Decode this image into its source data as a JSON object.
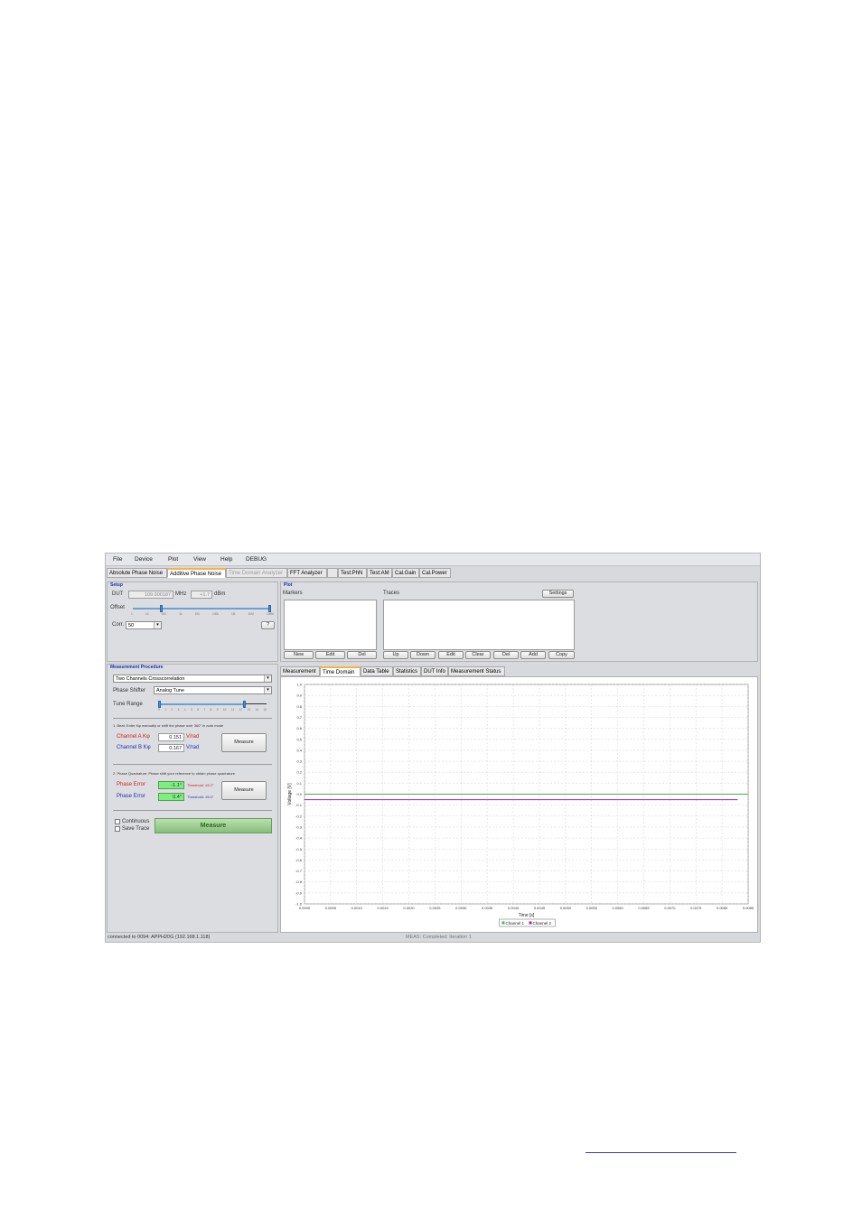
{
  "menu": [
    "File",
    "Device",
    "Plot",
    "View",
    "Help",
    "DEBUG"
  ],
  "tabs": [
    {
      "label": "Absolute Phase Noise",
      "state": "normal"
    },
    {
      "label": "Additive Phase Noise",
      "state": "active"
    },
    {
      "label": "Time Domain Analyzer",
      "state": "disabled"
    },
    {
      "label": "FFT Analyzer",
      "state": "normal"
    },
    {
      "label": "",
      "state": "normal"
    },
    {
      "label": "Test:PhN",
      "state": "normal"
    },
    {
      "label": "Test:AM",
      "state": "normal"
    },
    {
      "label": "Cal.Gain",
      "state": "normal"
    },
    {
      "label": "Cal.Power",
      "state": "normal"
    }
  ],
  "setup": {
    "title": "Setup",
    "dut_label": "DUT",
    "dut_freq": "109.000187",
    "freq_unit": "MHz",
    "dut_power": "+1.7",
    "power_unit": "dBm",
    "offset_label": "Offset",
    "offset_ticks": [
      "1",
      "10",
      "100",
      "1k",
      "10k",
      "100k",
      "1M",
      "10M",
      "100M"
    ],
    "corr_label": "Corr.",
    "corr_value": "50",
    "help_label": "?"
  },
  "plot": {
    "title": "Plot",
    "markers_label": "Markers",
    "traces_label": "Traces",
    "settings_label": "Settings",
    "marker_buttons": [
      "New",
      "Edit",
      "Del"
    ],
    "trace_buttons": [
      "Up",
      "Down",
      "Edit",
      "Clear",
      "Del",
      "Add",
      "Copy"
    ]
  },
  "procedure": {
    "title": "Measurement Procedure",
    "mode": "Two Channels Crosscorrelation",
    "phase_shifter_label": "Phase Shifter",
    "phase_shifter_value": "Analog Tune",
    "tune_range_label": "Tune Range",
    "tune_ticks": [
      "0",
      "1",
      "2",
      "3",
      "4",
      "5",
      "6",
      "7",
      "8",
      "9",
      "10",
      "11",
      "12",
      "13",
      "14",
      "15"
    ],
    "step1_text": "1. Beat: Enter Kφ manually or shift the phase over 360° in auto mode",
    "chan_a_label": "Channel A Kφ",
    "chan_a_value": "0.151",
    "chan_a_unit": "V/rad",
    "chan_b_label": "Channel B Kφ",
    "chan_b_value": "0.167",
    "chan_b_unit": "V/rad",
    "measure1_label": "Measure",
    "step2_text": "2. Phase Quadrature: Phase shift your reference to obtain phase quadrature",
    "phase_err_a_label": "Phase Error",
    "phase_err_a_value": "-1.1°",
    "phase_err_a_thresh": "Threshold: ±5.0°",
    "phase_err_b_label": "Phase Error",
    "phase_err_b_value": "0.4°",
    "phase_err_b_thresh": "Threshold: ±5.0°",
    "measure2_label": "Measure",
    "continuous_label": "Continuous",
    "save_trace_label": "Save Trace",
    "measure_main_label": "Measure"
  },
  "subtabs": [
    "Measurement",
    "Time Domain",
    "Data Table",
    "Statistics",
    "DUT Info",
    "Measurement Status"
  ],
  "active_subtab": "Time Domain",
  "status": {
    "left": "connected to 0094: APPH20G (192.168.1.118)",
    "mid": "MEAS: Completed: Iteration 1"
  },
  "chart_data": {
    "type": "line",
    "xlabel": "Time [s]",
    "ylabel": "Voltage [V]",
    "xlim": [
      0,
      0.0085
    ],
    "ylim": [
      -1.0,
      1.0
    ],
    "xticks": [
      "0.0000",
      "0.0005",
      "0.0010",
      "0.0015",
      "0.0020",
      "0.0025",
      "0.0030",
      "0.0035",
      "0.0040",
      "0.0045",
      "0.0050",
      "0.0055",
      "0.0060",
      "0.0065",
      "0.0070",
      "0.0075",
      "0.0080",
      "0.0085"
    ],
    "yticks": [
      "1.0",
      "0.9",
      "0.8",
      "0.7",
      "0.6",
      "0.5",
      "0.4",
      "0.3",
      "0.2",
      "0.1",
      "0.0",
      "-0.1",
      "-0.2",
      "-0.3",
      "-0.4",
      "-0.5",
      "-0.6",
      "-0.7",
      "-0.8",
      "-0.9",
      "-1.0"
    ],
    "grid": true,
    "legend_position": "bottom-center",
    "series": [
      {
        "name": "Channel 1",
        "color": "#4caf50",
        "x": [
          0,
          0.0085
        ],
        "values": [
          0.0,
          0.0
        ]
      },
      {
        "name": "Channel 2",
        "color": "#a020a0",
        "x": [
          0,
          0.0083
        ],
        "values": [
          -0.05,
          -0.05
        ]
      }
    ]
  }
}
